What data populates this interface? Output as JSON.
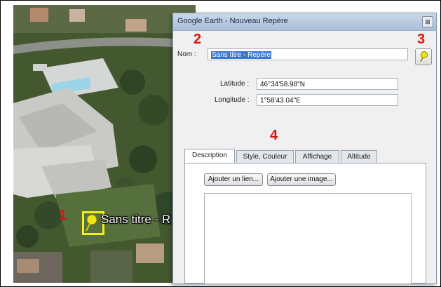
{
  "window": {
    "title": "Google Earth - Nouveau Repère",
    "close_glyph": "⊠"
  },
  "form": {
    "name_label": "Nom :",
    "name_value": "Sans titre - Repère",
    "latitude_label": "Latitude :",
    "latitude_value": "46°34'58.98\"N",
    "longitude_label": "Longitude :",
    "longitude_value": "1°58'43.04\"E"
  },
  "tabs": [
    {
      "label": "Description",
      "active": true
    },
    {
      "label": "Style, Couleur",
      "active": false
    },
    {
      "label": "Affichage",
      "active": false
    },
    {
      "label": "Altitude",
      "active": false
    }
  ],
  "description_panel": {
    "add_link_label": "Ajouter un lien...",
    "add_image_label": "Ajouter une image...",
    "text_value": ""
  },
  "map": {
    "placemark_label": "Sans titre - R"
  },
  "callouts": [
    "1",
    "2",
    "3",
    "4"
  ],
  "icons": {
    "placemark": "yellow-pushpin-icon",
    "close": "close-icon"
  },
  "colors": {
    "callout": "#e01010",
    "pin": "#f4ef1a",
    "selection": "#3a77d2"
  }
}
